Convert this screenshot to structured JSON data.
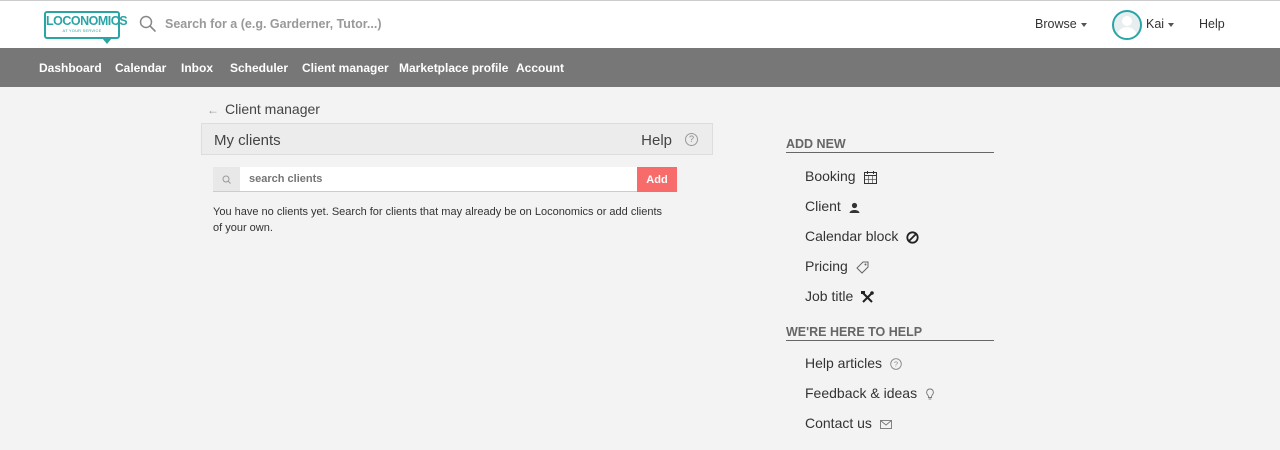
{
  "header": {
    "logo": {
      "main": "LOCONOMICS",
      "tagline": "AT YOUR SERVICE"
    },
    "search_placeholder": "Search for a (e.g. Garderner, Tutor...)",
    "browse_label": "Browse",
    "user_name": "Kai",
    "help_label": "Help"
  },
  "nav": {
    "items": [
      {
        "label": "Dashboard"
      },
      {
        "label": "Calendar"
      },
      {
        "label": "Inbox"
      },
      {
        "label": "Scheduler"
      },
      {
        "label": "Client manager"
      },
      {
        "label": "Marketplace profile"
      },
      {
        "label": "Account"
      }
    ]
  },
  "main": {
    "back_label": "Client manager",
    "panel_title": "My clients",
    "panel_help": "Help",
    "search_placeholder": "search clients",
    "add_button": "Add",
    "empty_message": "You have no clients yet. Search for clients that may already be on Loconomics or add clients of your own."
  },
  "sidebar": {
    "add_new": {
      "heading": "ADD NEW",
      "items": [
        {
          "label": "Booking",
          "icon": "calendar-icon"
        },
        {
          "label": "Client",
          "icon": "user-icon"
        },
        {
          "label": "Calendar block",
          "icon": "block-icon"
        },
        {
          "label": "Pricing",
          "icon": "tag-icon"
        },
        {
          "label": "Job title",
          "icon": "tools-icon"
        }
      ]
    },
    "help": {
      "heading": "WE'RE HERE TO HELP",
      "items": [
        {
          "label": "Help articles",
          "icon": "question-icon"
        },
        {
          "label": "Feedback & ideas",
          "icon": "lightbulb-icon"
        },
        {
          "label": "Contact us",
          "icon": "envelope-icon"
        }
      ]
    }
  },
  "colors": {
    "brand": "#2aa5a5",
    "nav_bg": "#777777",
    "add_button": "#f76b6b",
    "page_bg": "#f3f3f3"
  }
}
